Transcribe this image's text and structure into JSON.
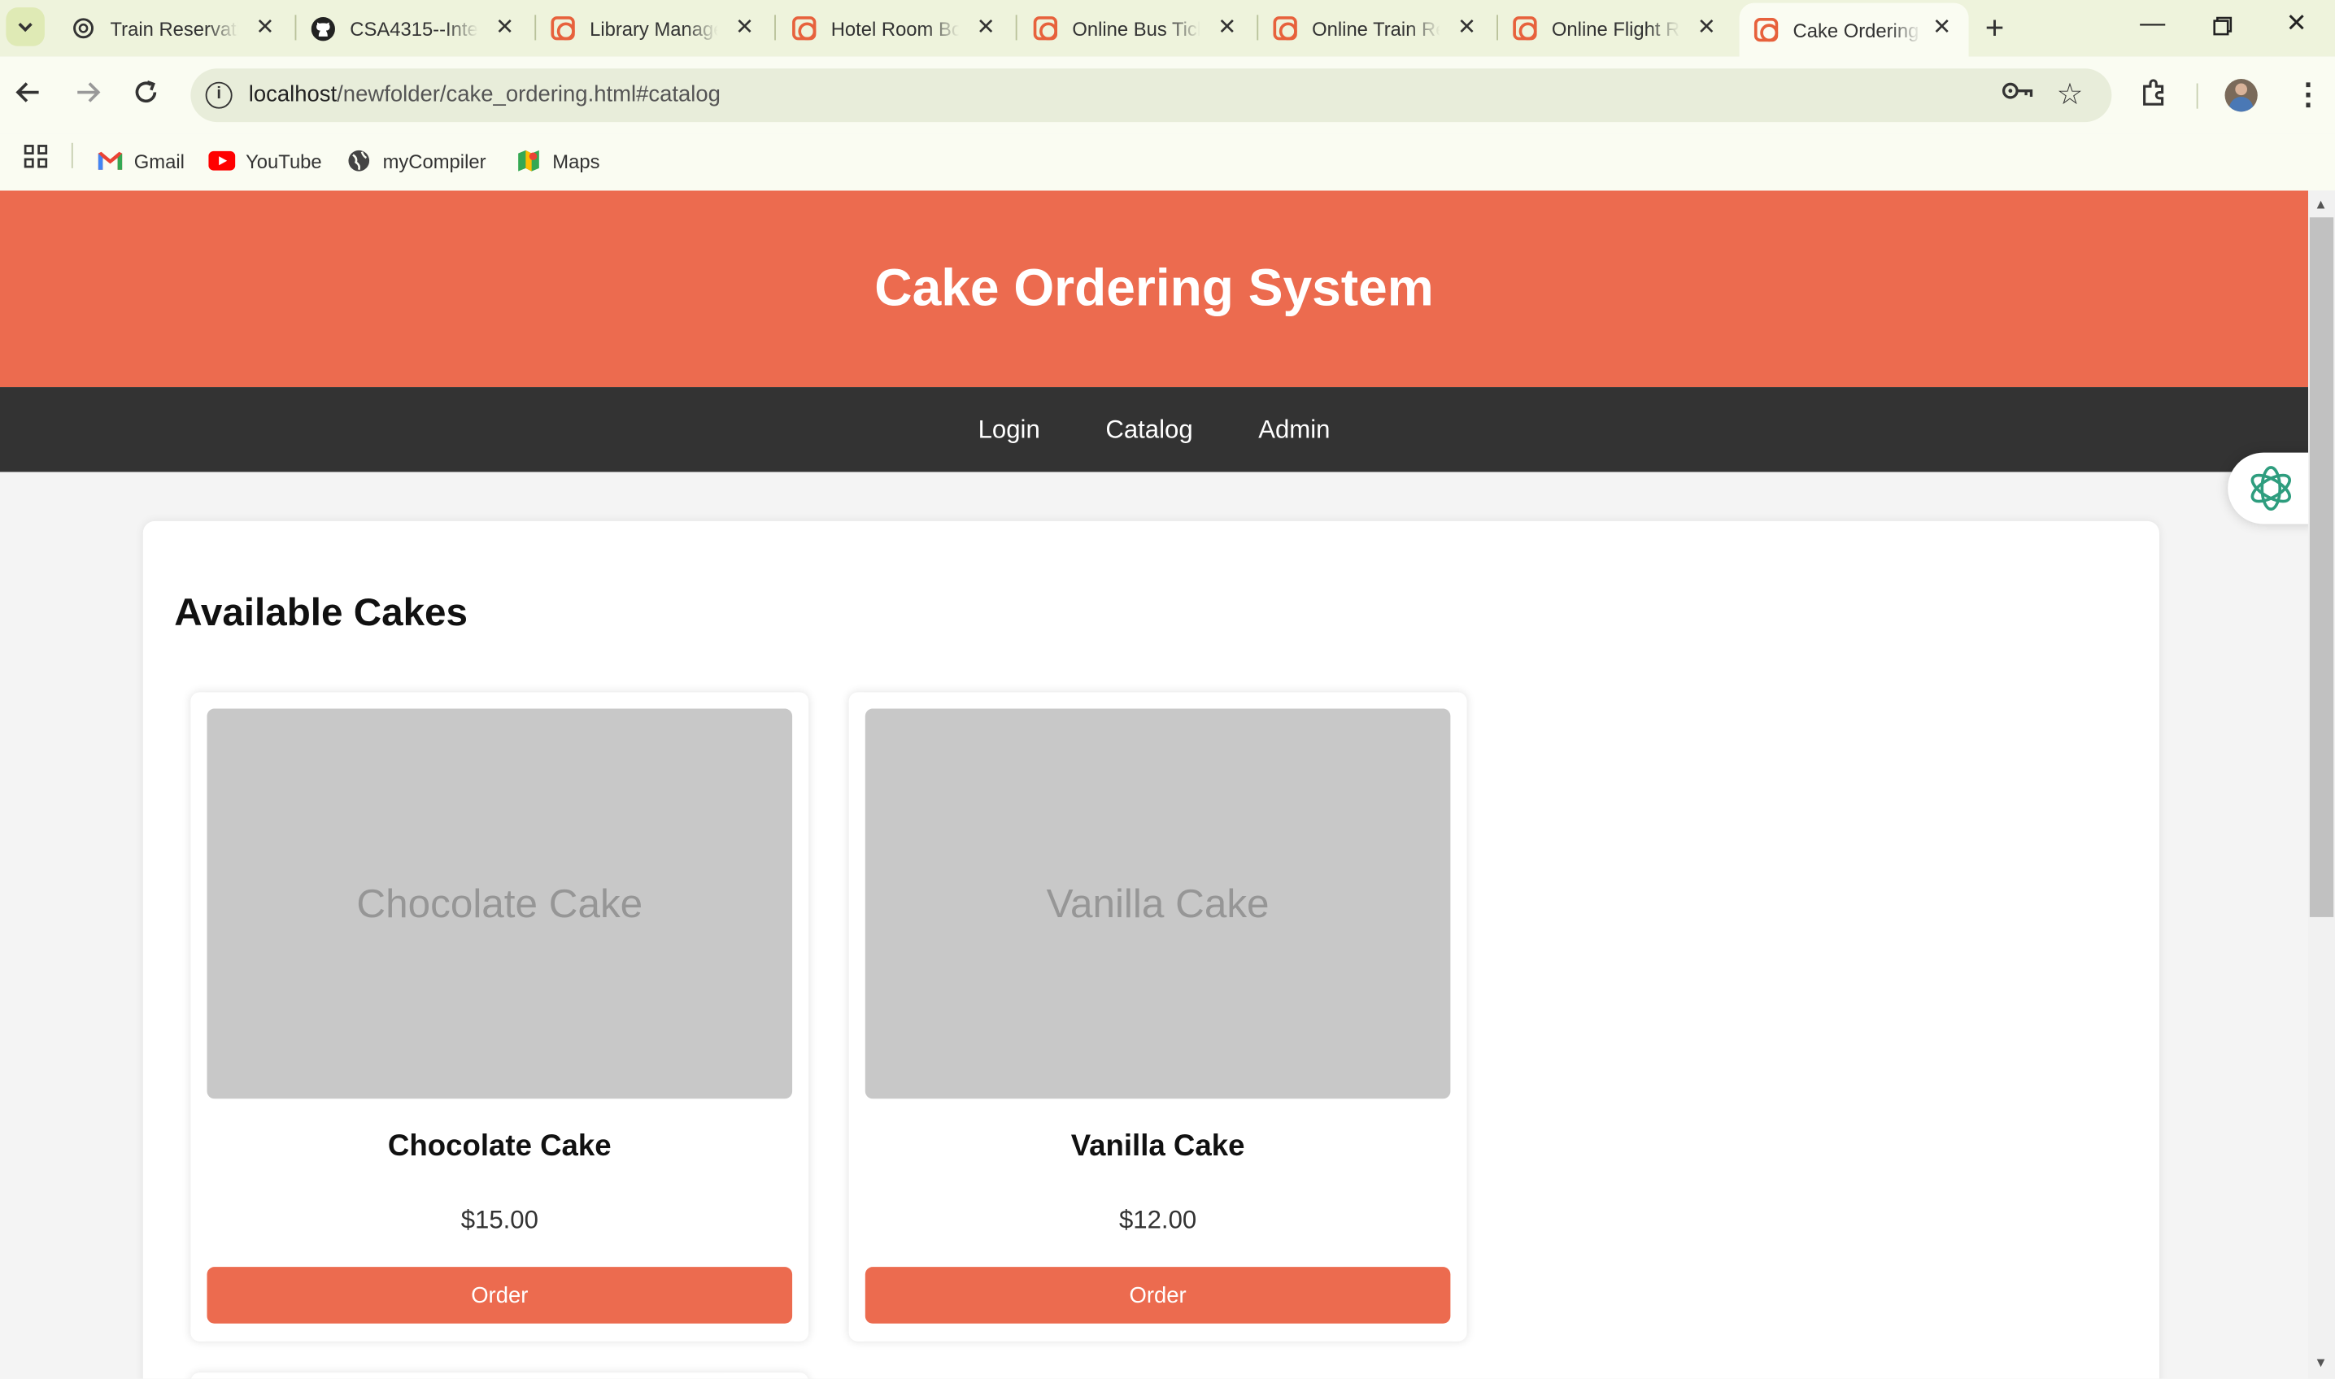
{
  "browser": {
    "tabs": [
      {
        "title": "Train Reservation",
        "icon": "openai-icon"
      },
      {
        "title": "CSA4315--Internet",
        "icon": "github-icon"
      },
      {
        "title": "Library Management",
        "icon": "xampp-icon"
      },
      {
        "title": "Hotel Room Booking",
        "icon": "xampp-icon"
      },
      {
        "title": "Online Bus Ticket",
        "icon": "xampp-icon"
      },
      {
        "title": "Online Train Reservation",
        "icon": "xampp-icon"
      },
      {
        "title": "Online Flight Reservation",
        "icon": "xampp-icon"
      },
      {
        "title": "Cake Ordering",
        "icon": "xampp-icon",
        "active": true
      }
    ],
    "url_host": "localhost",
    "url_path": "/newfolder/cake_ordering.html#catalog",
    "bookmarks": [
      {
        "label": "Gmail",
        "icon": "gmail-icon"
      },
      {
        "label": "YouTube",
        "icon": "youtube-icon"
      },
      {
        "label": "myCompiler",
        "icon": "globe-icon"
      },
      {
        "label": "Maps",
        "icon": "maps-icon"
      }
    ]
  },
  "page": {
    "title": "Cake Ordering System",
    "nav": [
      "Login",
      "Catalog",
      "Admin"
    ],
    "section_title": "Available Cakes",
    "cakes": [
      {
        "image_text": "Chocolate Cake",
        "name": "Chocolate Cake",
        "price": "$15.00",
        "button": "Order"
      },
      {
        "image_text": "Vanilla Cake",
        "name": "Vanilla Cake",
        "price": "$12.00",
        "button": "Order"
      }
    ]
  },
  "colors": {
    "accent": "#ec6b4f",
    "nav_bg": "#333333",
    "page_bg": "#f4f4f4"
  }
}
